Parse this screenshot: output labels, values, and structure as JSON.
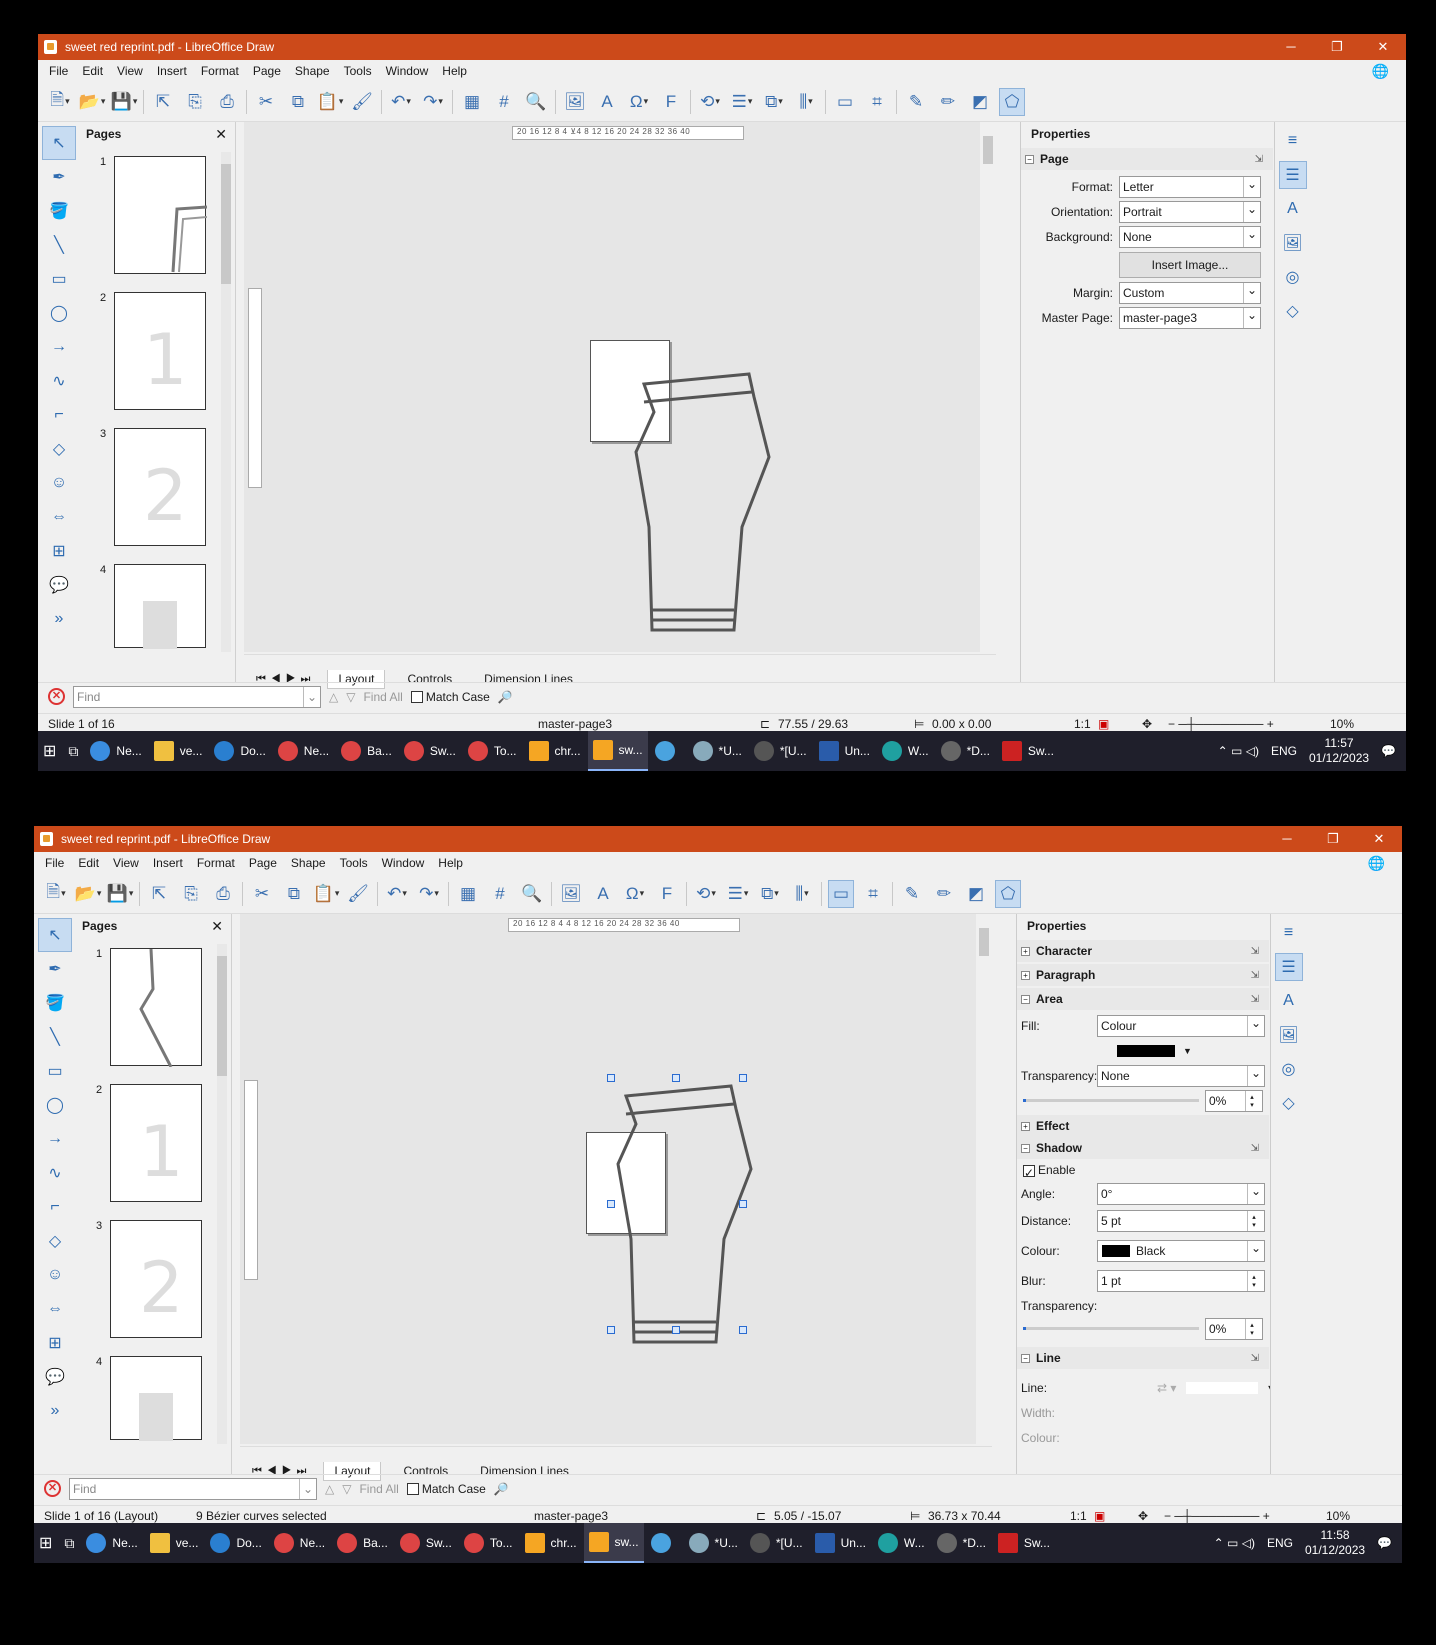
{
  "windows": [
    {
      "title": "sweet red reprint.pdf - LibreOffice Draw",
      "menu": [
        "File",
        "Edit",
        "View",
        "Insert",
        "Format",
        "Page",
        "Shape",
        "Tools",
        "Window",
        "Help"
      ],
      "pages_panel": {
        "title": "Pages",
        "thumbs": [
          "1",
          "2",
          "3",
          "4"
        ]
      },
      "ruler_h": "20 16 12  8  4  ⊻4  8 12 16 20 24 28 32 36 40",
      "tabs": [
        "Layout",
        "Controls",
        "Dimension Lines"
      ],
      "sidebar_title": "Properties",
      "page_section": {
        "heading": "Page",
        "format_label": "Format:",
        "format_value": "Letter",
        "orientation_label": "Orientation:",
        "orientation_value": "Portrait",
        "background_label": "Background:",
        "background_value": "None",
        "insert_image": "Insert Image...",
        "margin_label": "Margin:",
        "margin_value": "Custom",
        "master_label": "Master Page:",
        "master_value": "master-page3"
      },
      "find": {
        "placeholder": "Find",
        "find_all": "Find All",
        "match_case": "Match Case"
      },
      "status": {
        "slide": "Slide 1 of 16",
        "master": "master-page3",
        "position": "77.55 / 29.63",
        "size": "0.00 x 0.00",
        "scale": "1:1",
        "zoom": "10%"
      }
    },
    {
      "title": "sweet red reprint.pdf - LibreOffice Draw",
      "menu": [
        "File",
        "Edit",
        "View",
        "Insert",
        "Format",
        "Page",
        "Shape",
        "Tools",
        "Window",
        "Help"
      ],
      "pages_panel": {
        "title": "Pages",
        "thumbs": [
          "1",
          "2",
          "3",
          "4"
        ]
      },
      "ruler_h": "20 16 12  8  4   4  8 12 16 20 24 28 32 36 40",
      "tabs": [
        "Layout",
        "Controls",
        "Dimension Lines"
      ],
      "sidebar_title": "Properties",
      "sections": {
        "character": "Character",
        "paragraph": "Paragraph",
        "area": "Area",
        "fill_label": "Fill:",
        "fill_value": "Colour",
        "transparency_label": "Transparency:",
        "transparency_value": "None",
        "transparency_pct": "0%",
        "effect": "Effect",
        "shadow": "Shadow",
        "enable": "Enable",
        "angle_label": "Angle:",
        "angle_value": "0°",
        "distance_label": "Distance:",
        "distance_value": "5 pt",
        "colour_label": "Colour:",
        "colour_value": "Black",
        "blur_label": "Blur:",
        "blur_value": "1 pt",
        "shadow_transparency_label": "Transparency:",
        "shadow_transparency_pct": "0%",
        "line": "Line",
        "line_label": "Line:",
        "width_label": "Width:",
        "line_colour_label": "Colour:"
      },
      "find": {
        "placeholder": "Find",
        "find_all": "Find All",
        "match_case": "Match Case"
      },
      "status": {
        "slide": "Slide 1 of 16 (Layout)",
        "selection": "9 Bézier curves selected",
        "master": "master-page3",
        "position": "5.05 / -15.07",
        "size": "36.73 x 70.44",
        "scale": "1:1",
        "zoom": "10%"
      }
    }
  ],
  "taskbar": {
    "items": [
      "Ne...",
      "ve...",
      "Do...",
      "Ne...",
      "Ba...",
      "Sw...",
      "To...",
      "chr...",
      "sw...",
      "",
      "*U...",
      "*[U...",
      "Un...",
      "W...",
      "*D...",
      "Sw..."
    ],
    "lang": "ENG",
    "clock1": {
      "time": "11:57",
      "date": "01/12/2023"
    },
    "clock2": {
      "time": "11:58",
      "date": "01/12/2023"
    }
  },
  "colors": {
    "titlebar": "#cc4a1a",
    "accent": "#2e6bb0",
    "taskbar": "#1f1f2b"
  }
}
